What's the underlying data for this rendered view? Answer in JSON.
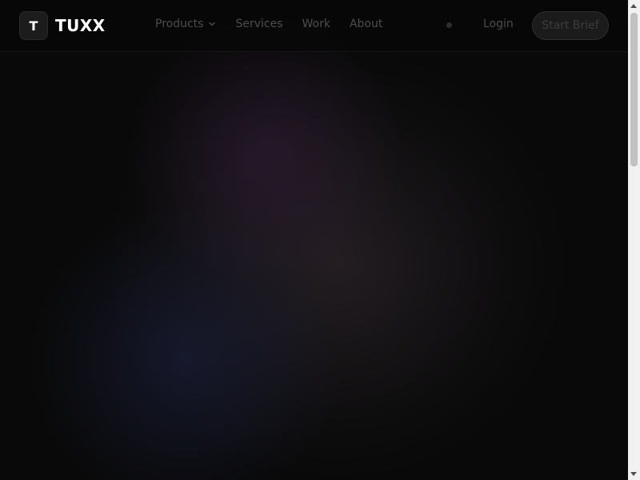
{
  "brand": {
    "mark": "T",
    "name": "TUXX"
  },
  "nav": {
    "links": [
      {
        "label": "Products",
        "has_dropdown": true
      },
      {
        "label": "Services"
      },
      {
        "label": "Work"
      },
      {
        "label": "About"
      }
    ],
    "login_label": "Login",
    "cta_label": "Start Brief"
  },
  "icons": {
    "dropdown": "chevron-down-icon",
    "theme": "theme-toggle-dot-icon"
  },
  "colors": {
    "background": "#0a0a0a",
    "nav_text": "#4d4d4d",
    "cta_bg": "#1b1b1b",
    "brand_text": "#ffffff"
  }
}
